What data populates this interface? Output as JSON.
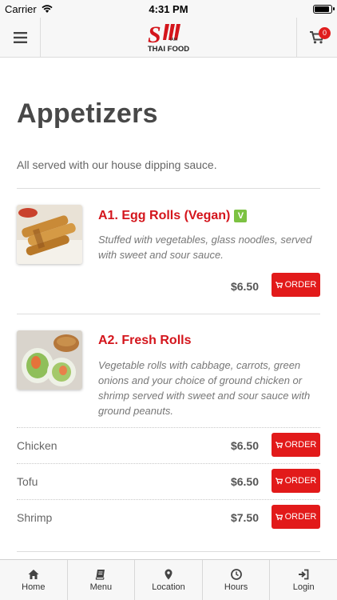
{
  "status_bar": {
    "carrier": "Carrier",
    "time": "4:31 PM",
    "battery_level": 0.95
  },
  "header": {
    "logo_text": "THAI FOOD",
    "logo_letter": "S",
    "logo_small": "IAM",
    "cart_count": "0",
    "menu_icon": "hamburger-icon",
    "cart_icon": "cart-icon"
  },
  "section": {
    "title": "Appetizers",
    "description": "All served with our house dipping sauce."
  },
  "items": [
    {
      "name": "A1. Egg Rolls (Vegan)",
      "badge": "V",
      "description": "Stuffed with vegetables, glass noodles, served with sweet and sour sauce.",
      "price": "$6.50",
      "order_label": "ORDER"
    },
    {
      "name": "A2. Fresh Rolls",
      "description": "Vegetable rolls with cabbage, carrots, green onions and your choice of ground chicken or shrimp served with sweet and sour sauce with ground peanuts.",
      "options": [
        {
          "label": "Chicken",
          "price": "$6.50",
          "order_label": "ORDER"
        },
        {
          "label": "Tofu",
          "price": "$6.50",
          "order_label": "ORDER"
        },
        {
          "label": "Shrimp",
          "price": "$7.50",
          "order_label": "ORDER"
        }
      ]
    }
  ],
  "bottom_nav": [
    {
      "label": "Home",
      "icon": "home-icon"
    },
    {
      "label": "Menu",
      "icon": "book-icon"
    },
    {
      "label": "Location",
      "icon": "map-pin-icon"
    },
    {
      "label": "Hours",
      "icon": "clock-icon"
    },
    {
      "label": "Login",
      "icon": "login-icon"
    }
  ],
  "colors": {
    "accent": "#e21a1a",
    "title_red": "#d4151c",
    "veg_green": "#7cc242",
    "badge_red": "#e01e1e"
  }
}
